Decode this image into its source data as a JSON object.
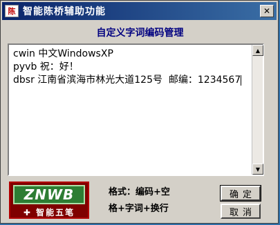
{
  "window": {
    "icon_text": "陈",
    "title": "智能陈桥辅助功能",
    "close_glyph": "✕"
  },
  "heading": "自定义字词编码管理",
  "editor": {
    "lines": [
      "cwin 中文WindowsXP",
      "pyvb 祝：好！",
      "dbsr 江南省滨海市林光大道125号  邮编：1234567"
    ]
  },
  "logo": {
    "top_text": "ZNWB",
    "bottom_text": "✚ 智能五笔"
  },
  "hint": {
    "line1": "格式：编码+空",
    "line2": "格+字词+换行"
  },
  "buttons": {
    "ok": "确定",
    "cancel": "取消"
  },
  "scrollbar": {
    "up_glyph": "▲",
    "down_glyph": "▼"
  }
}
